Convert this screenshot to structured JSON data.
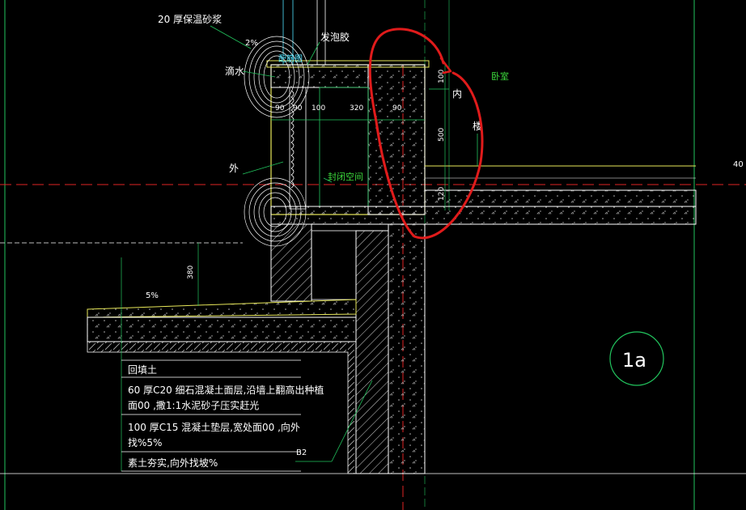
{
  "colors": {
    "background": "#000000",
    "line_white": "#ffffff",
    "line_green": "#22c55e",
    "line_yellow": "#e8e85a",
    "line_red": "#e02424",
    "line_cyan": "#4fe3ff",
    "markup_red": "#e01b1b"
  },
  "labels": {
    "insulation_mortar": "20 厚保温砂浆",
    "slope_top": "2%",
    "foam_glue": "发泡胶",
    "drip": "滴水",
    "bedroom": "卧室",
    "inside": "内",
    "floor": "楼",
    "outside": "外",
    "sealed_space": "封闭空间",
    "slope_ground": "5%",
    "ref_1a": "1a",
    "marker_40": "40",
    "pointer_b2": "B2",
    "cyan_tag": "配筋图"
  },
  "dimensions": {
    "d100_top": "100",
    "d500": "500",
    "d120": "120",
    "d90_left": "90",
    "d90_b": "90",
    "d100_mid": "100",
    "d320": "320",
    "d90_right": "90",
    "d380": "380"
  },
  "legend": {
    "row1": "回填土",
    "row2_line1": "60 厚C20 细石混凝土面层,沿墙上翻高出种植",
    "row2_line2": "面00 ,撒1:1水泥砂子压实赶光",
    "row3_line1": "100 厚C15 混凝土垫层,宽处面00 ,向外",
    "row3_line2": "找%5%",
    "row4": "素土夯实,向外找坡%"
  }
}
